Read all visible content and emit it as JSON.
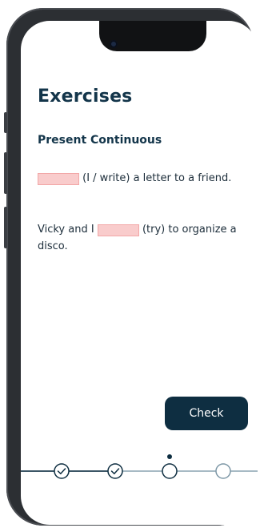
{
  "page": {
    "title": "Exercises",
    "subtitle": "Present Continuous"
  },
  "exercises": [
    {
      "before": "",
      "blank_value": "",
      "after": " (I / write) a letter to a friend."
    },
    {
      "before": "Vicky and I ",
      "blank_value": "",
      "after": " (try) to organize a disco."
    }
  ],
  "actions": {
    "check_label": "Check"
  },
  "progress": {
    "total_steps": 4,
    "completed_steps": 2,
    "current_step": 3
  },
  "colors": {
    "primary": "#0e2e41",
    "blank_fill": "#f9cccc",
    "blank_border": "#f2a7a7",
    "text": "#13354a"
  }
}
